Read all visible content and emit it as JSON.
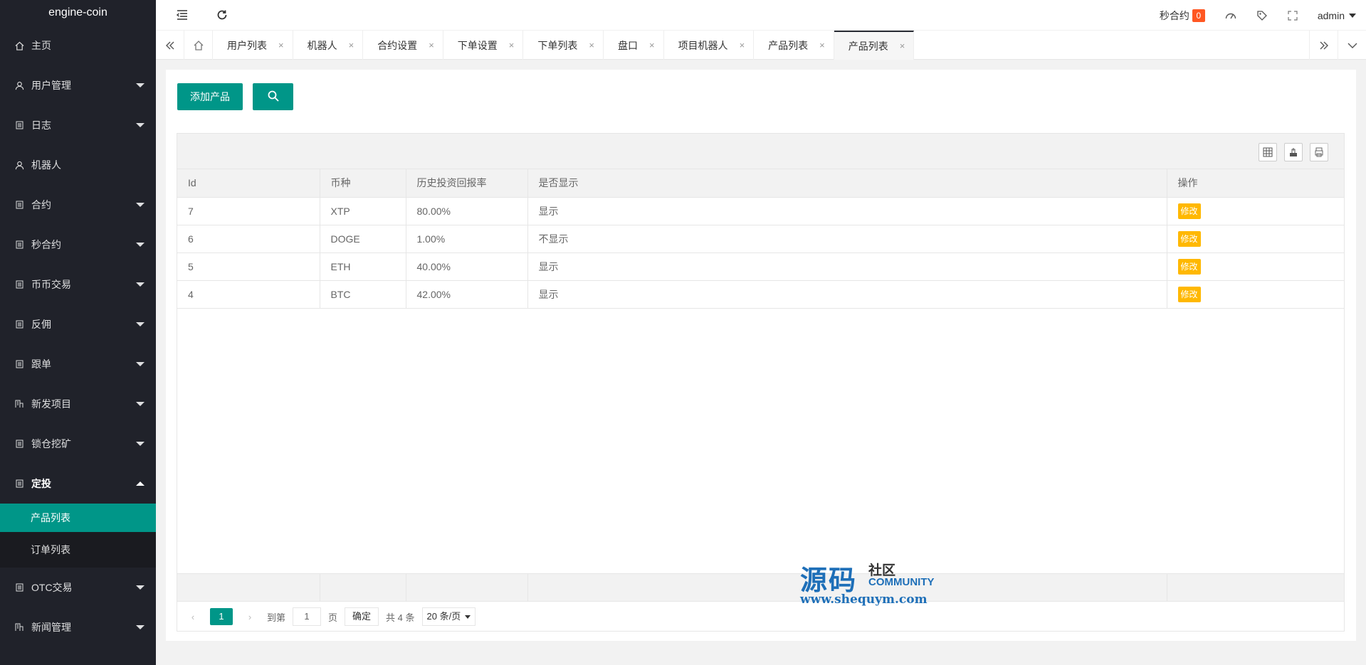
{
  "app": {
    "title": "engine-coin"
  },
  "sidebar": {
    "items": [
      {
        "label": "主页",
        "icon": "home-icon",
        "has_caret": false
      },
      {
        "label": "用户管理",
        "icon": "user-icon",
        "has_caret": true
      },
      {
        "label": "日志",
        "icon": "doc-icon",
        "has_caret": true
      },
      {
        "label": "机器人",
        "icon": "user-icon",
        "has_caret": false
      },
      {
        "label": "合约",
        "icon": "doc-icon",
        "has_caret": true
      },
      {
        "label": "秒合约",
        "icon": "doc-icon",
        "has_caret": true
      },
      {
        "label": "币币交易",
        "icon": "doc-icon",
        "has_caret": true
      },
      {
        "label": "反佣",
        "icon": "doc-icon",
        "has_caret": true
      },
      {
        "label": "跟单",
        "icon": "doc-icon",
        "has_caret": true
      },
      {
        "label": "新发项目",
        "icon": "building-icon",
        "has_caret": true
      },
      {
        "label": "锁仓挖矿",
        "icon": "doc-icon",
        "has_caret": true
      },
      {
        "label": "定投",
        "icon": "doc-icon",
        "has_caret": true,
        "open": true
      }
    ],
    "sub_items": [
      {
        "label": "产品列表",
        "active": true
      },
      {
        "label": "订单列表",
        "active": false
      }
    ],
    "bottom_items": [
      {
        "label": "OTC交易",
        "icon": "doc-icon"
      },
      {
        "label": "新闻管理",
        "icon": "building-icon"
      }
    ]
  },
  "header": {
    "second_contract_label": "秒合约",
    "second_contract_count": "0",
    "user": "admin"
  },
  "tabs": [
    {
      "label": "用户列表",
      "active": false
    },
    {
      "label": "机器人",
      "active": false
    },
    {
      "label": "合约设置",
      "active": false
    },
    {
      "label": "下单设置",
      "active": false
    },
    {
      "label": "下单列表",
      "active": false
    },
    {
      "label": "盘口",
      "active": false
    },
    {
      "label": "项目机器人",
      "active": false
    },
    {
      "label": "产品列表",
      "active": false
    },
    {
      "label": "产品列表",
      "active": true
    }
  ],
  "actions": {
    "add_label": "添加产品"
  },
  "table": {
    "columns": [
      "Id",
      "币种",
      "历史投资回报率",
      "是否显示",
      "操作"
    ],
    "rows": [
      {
        "id": "7",
        "coin": "XTP",
        "rate": "80.00%",
        "show": "显示",
        "op": "修改"
      },
      {
        "id": "6",
        "coin": "DOGE",
        "rate": "1.00%",
        "show": "不显示",
        "op": "修改"
      },
      {
        "id": "5",
        "coin": "ETH",
        "rate": "40.00%",
        "show": "显示",
        "op": "修改"
      },
      {
        "id": "4",
        "coin": "BTC",
        "rate": "42.00%",
        "show": "显示",
        "op": "修改"
      }
    ]
  },
  "pager": {
    "current": "1",
    "goto_label": "到第",
    "goto_value": "1",
    "page_label": "页",
    "confirm": "确定",
    "total": "共 4 条",
    "per_page": "20 条/页"
  },
  "watermark": {
    "big": "源码",
    "small": "社区",
    "community": "COMMUNITY",
    "url": "www.shequym.com"
  }
}
